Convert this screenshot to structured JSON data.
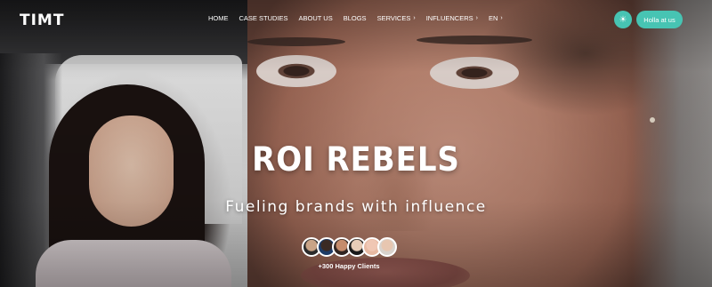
{
  "brand": {
    "logo_text": "TIMT"
  },
  "nav": {
    "items": [
      {
        "label": "HOME",
        "has_dropdown": false
      },
      {
        "label": "CASE STUDIES",
        "has_dropdown": false
      },
      {
        "label": "ABOUT US",
        "has_dropdown": false
      },
      {
        "label": "BLOGS",
        "has_dropdown": false
      },
      {
        "label": "SERVICES",
        "has_dropdown": true
      },
      {
        "label": "INFLUENCERS",
        "has_dropdown": true
      },
      {
        "label": "EN",
        "has_dropdown": true
      }
    ],
    "theme_toggle_icon": "sun-icon",
    "contact_label": "Holla at us"
  },
  "hero": {
    "title": "ROI REBELS",
    "subtitle": "Fueling brands with influence",
    "clients_label": "+300 Happy Clients",
    "avatar_count": 6
  },
  "colors": {
    "accent": "#47c4b3",
    "text": "#ffffff"
  }
}
